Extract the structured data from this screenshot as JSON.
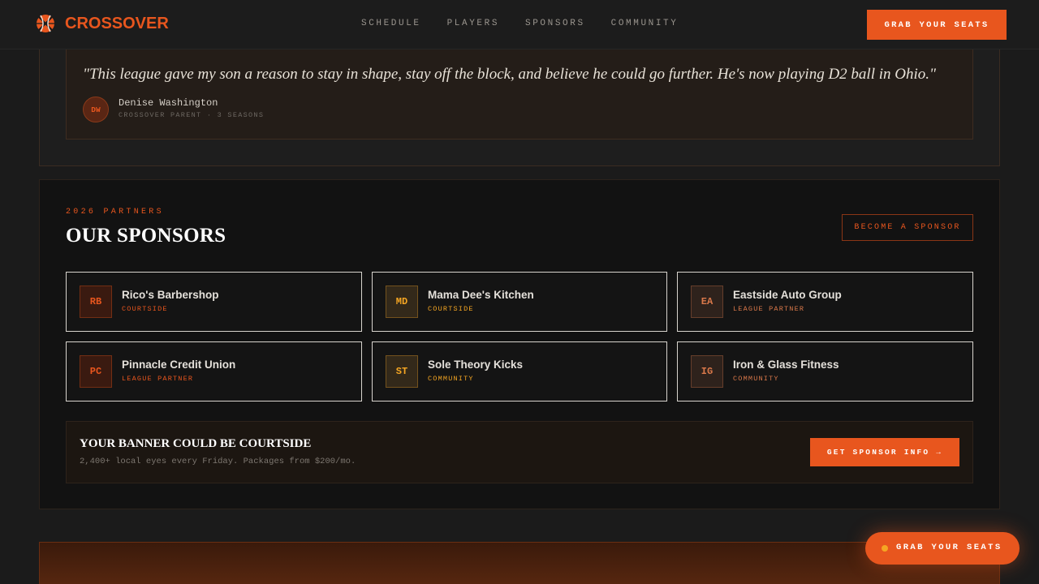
{
  "nav": {
    "brand": "CROSSOVER",
    "links": [
      "SCHEDULE",
      "PLAYERS",
      "SPONSORS",
      "COMMUNITY"
    ],
    "cta": "GRAB YOUR SEATS"
  },
  "testimonial": {
    "quote": "\"This league gave my son a reason to stay in shape, stay off the block, and believe he could go further. He's now playing D2 ball in Ohio.\"",
    "initials": "DW",
    "name": "Denise Washington",
    "role": "CROSSOVER PARENT · 3 SEASONS"
  },
  "sponsors": {
    "kicker": "2026 PARTNERS",
    "title": "OUR SPONSORS",
    "become_label": "BECOME A SPONSOR",
    "items": [
      {
        "initials": "RB",
        "name": "Rico's Barbershop",
        "tier": "COURTSIDE",
        "color": "#e8561e",
        "bg": "#3a1a10"
      },
      {
        "initials": "MD",
        "name": "Mama Dee's Kitchen",
        "tier": "COURTSIDE",
        "color": "#f5a623",
        "bg": "#33291a"
      },
      {
        "initials": "EA",
        "name": "Eastside Auto Group",
        "tier": "LEAGUE PARTNER",
        "color": "#d9784a",
        "bg": "#2e221c"
      },
      {
        "initials": "PC",
        "name": "Pinnacle Credit Union",
        "tier": "LEAGUE PARTNER",
        "color": "#e8561e",
        "bg": "#3a1a10"
      },
      {
        "initials": "ST",
        "name": "Sole Theory Kicks",
        "tier": "COMMUNITY",
        "color": "#f5a623",
        "bg": "#33291a"
      },
      {
        "initials": "IG",
        "name": "Iron & Glass Fitness",
        "tier": "COMMUNITY",
        "color": "#d9784a",
        "bg": "#2e221c"
      }
    ]
  },
  "banner": {
    "title": "YOUR BANNER COULD BE COURTSIDE",
    "subtitle": "2,400+ local eyes every Friday. Packages from $200/mo.",
    "cta": "GET SPONSOR INFO →"
  },
  "fab": {
    "label": "GRAB YOUR SEATS"
  }
}
